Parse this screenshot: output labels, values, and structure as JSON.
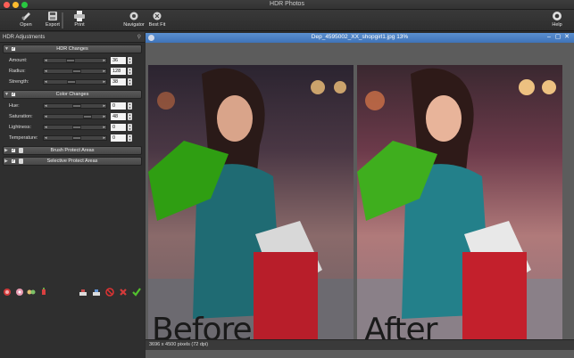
{
  "window": {
    "title": "HDR Photos"
  },
  "toolbar": {
    "open": "Open",
    "export": "Export",
    "print": "Print",
    "navigator": "Navigator",
    "best_fit": "Best Fit",
    "help": "Help"
  },
  "left_panel": {
    "title": "HDR Adjustments",
    "hdr_changes": {
      "title": "HDR Changes",
      "rows": [
        {
          "label": "Amount:",
          "value": "36",
          "fraction": 0.36
        },
        {
          "label": "Radius:",
          "value": "128",
          "fraction": 0.5
        },
        {
          "label": "Strength:",
          "value": "38",
          "fraction": 0.38
        }
      ]
    },
    "color_changes": {
      "title": "Color Changes",
      "rows": [
        {
          "label": "Hue:",
          "value": "0",
          "fraction": 0.5
        },
        {
          "label": "Saturation:",
          "value": "48",
          "fraction": 0.74
        },
        {
          "label": "Lightness:",
          "value": "0",
          "fraction": 0.5
        },
        {
          "label": "Temperature:",
          "value": "0",
          "fraction": 0.5
        }
      ]
    },
    "brush_protect": "Brush Protect Areas",
    "selective_protect": "Selective Protect Areas"
  },
  "image_window": {
    "title": "Dep_4595002_XX_shopgirl1.jpg 13%",
    "caption_before": "Before",
    "caption_after": "After",
    "status": "3696 x 4500 pixels (72 dpi)"
  },
  "colors": {
    "accent_blue": "#4a82c6",
    "bag_green": "#3fae1e",
    "bag_red": "#c3202c"
  }
}
